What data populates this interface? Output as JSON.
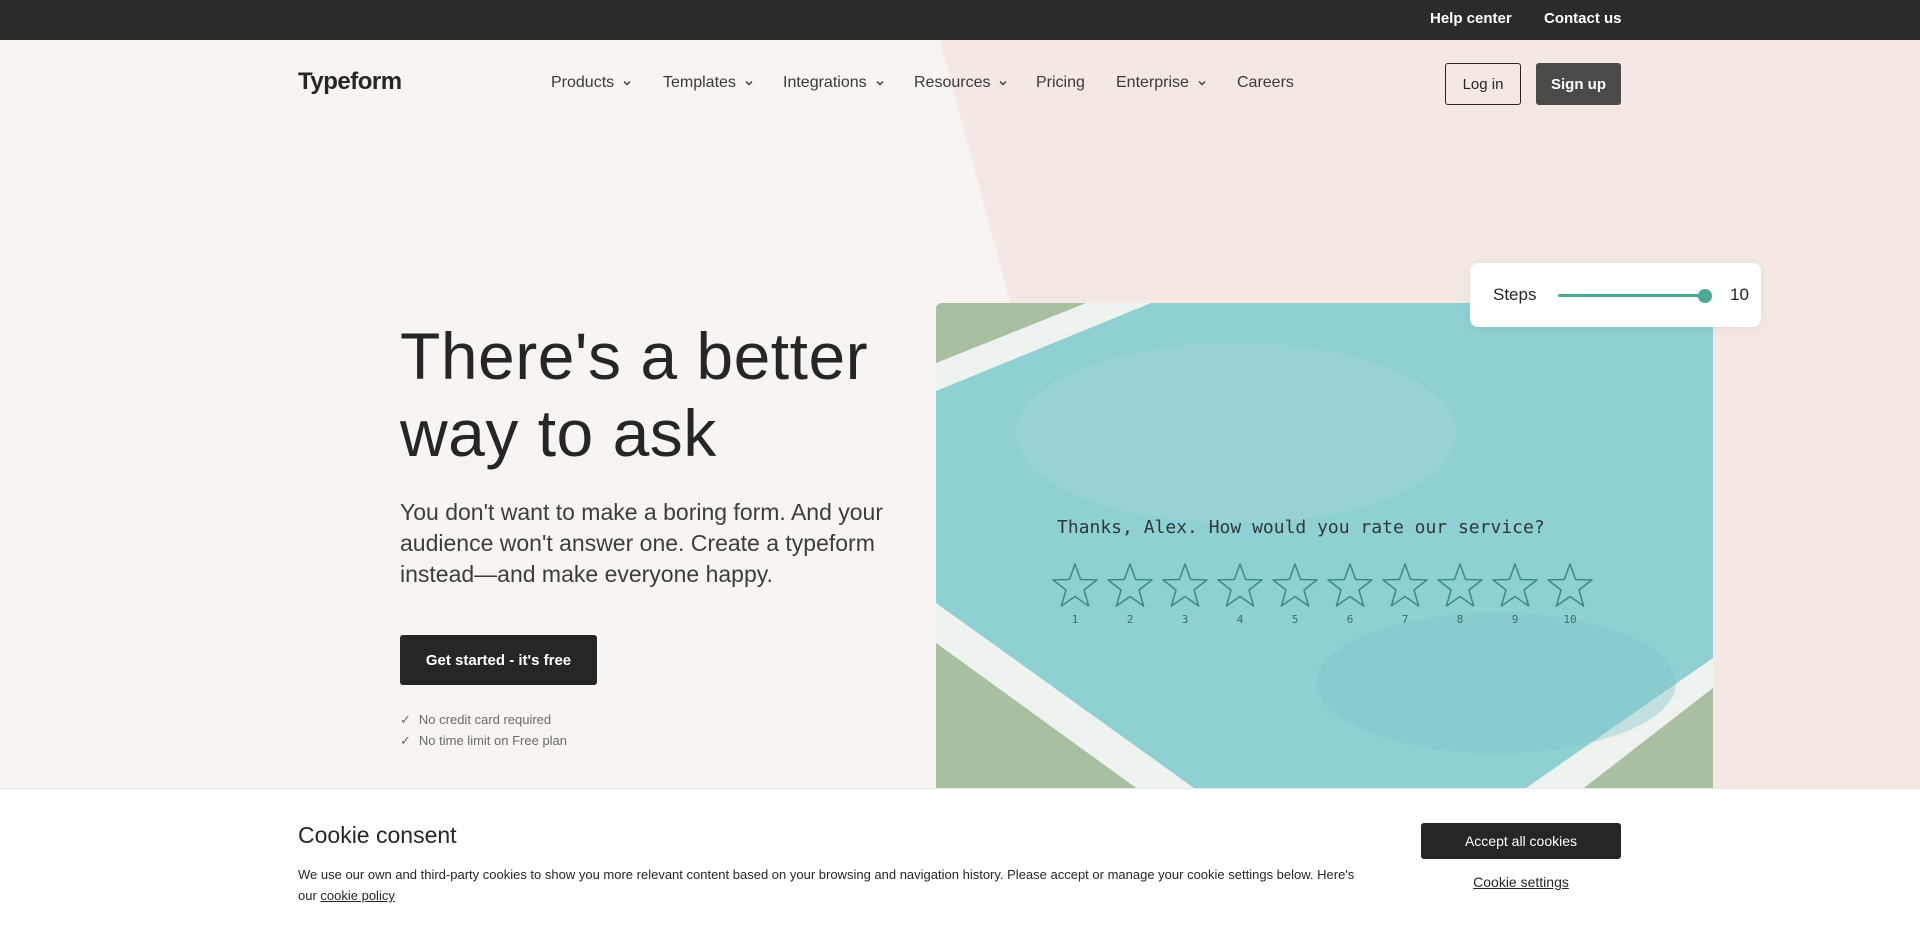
{
  "topbar": {
    "help": "Help center",
    "contact": "Contact us"
  },
  "nav": {
    "logo": "Typeform",
    "menu": [
      {
        "label": "Products"
      },
      {
        "label": "Templates"
      },
      {
        "label": "Integrations"
      },
      {
        "label": "Resources"
      },
      {
        "label": "Pricing"
      },
      {
        "label": "Enterprise"
      },
      {
        "label": "Careers"
      }
    ],
    "login": "Log in",
    "signup": "Sign up"
  },
  "hero": {
    "title": "There's a better way to ask",
    "subtitle": "You don't want to make a boring form. And your audience won't answer one. Create a typeform instead—and make everyone happy.",
    "cta": "Get started - it's free",
    "checks": [
      "No credit card required",
      "No time limit on Free plan"
    ]
  },
  "demo": {
    "question": "Thanks, Alex. How would you rate our service?",
    "ratings": [
      "1",
      "2",
      "3",
      "4",
      "5",
      "6",
      "7",
      "8",
      "9",
      "10"
    ],
    "steps_label": "Steps",
    "steps_value": "10",
    "accent": "#4aa896",
    "card_color": "#88cbcf"
  },
  "cookie": {
    "title": "Cookie consent",
    "text": "We use our own and third-party cookies to show you more relevant content based on your browsing and navigation history. Please accept or manage your cookie settings below. Here's our ",
    "link": "cookie policy",
    "accept": "Accept all cookies",
    "settings": "Cookie settings"
  }
}
